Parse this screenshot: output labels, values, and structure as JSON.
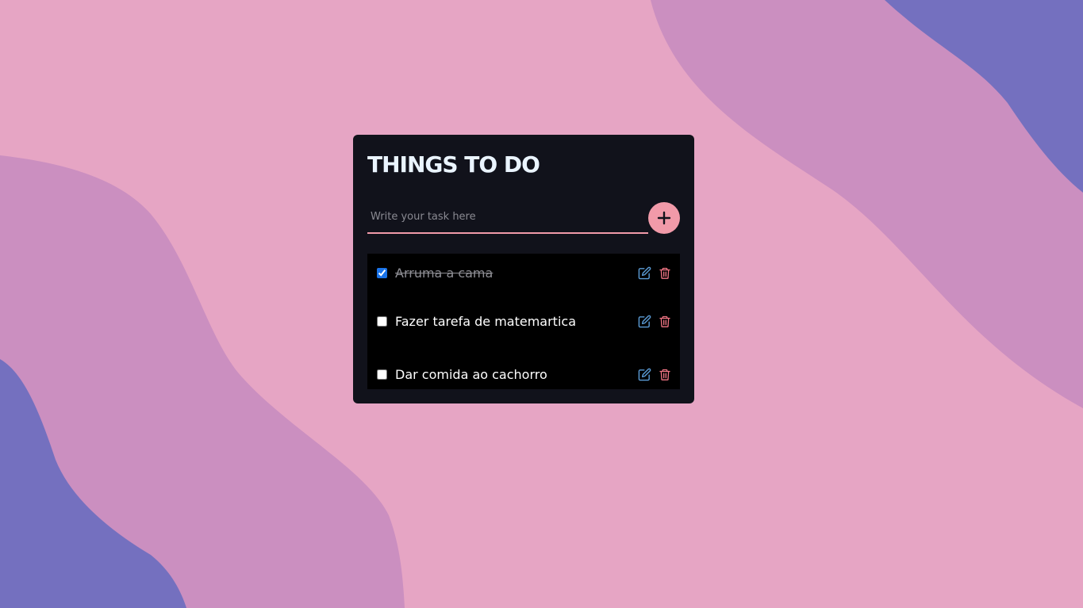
{
  "app": {
    "title": "THINGS TO DO"
  },
  "new_task": {
    "placeholder": "Write your task here",
    "value": "",
    "add_icon": "plus-icon"
  },
  "tasks": [
    {
      "text": "Arruma a cama",
      "done": true,
      "edit_icon": "edit-icon",
      "delete_icon": "trash-icon"
    },
    {
      "text": "Fazer tarefa de matemartica",
      "done": false,
      "edit_icon": "edit-icon",
      "delete_icon": "trash-icon"
    },
    {
      "text": "Dar comida ao cachorro",
      "done": false,
      "edit_icon": "edit-icon",
      "delete_icon": "trash-icon"
    }
  ],
  "colors": {
    "background": "#e6a5c4",
    "wave_mid": "#cb8fc0",
    "wave_dark": "#7470bf",
    "card": "#11121b",
    "accent_pink": "#f19aa9",
    "edit_blue": "#5b9bd5",
    "delete_red": "#f07584"
  }
}
